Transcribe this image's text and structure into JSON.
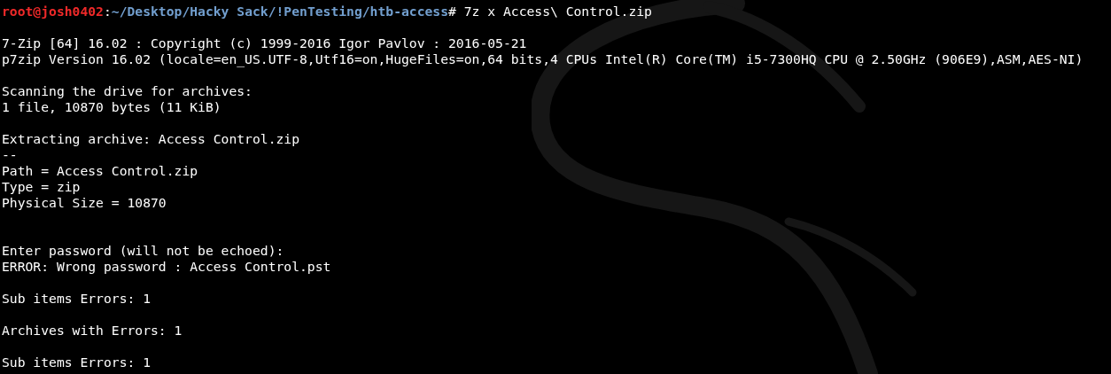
{
  "prompt": {
    "user_host": "root@josh0402",
    "separator": ":",
    "path": "~/Desktop/Hacky Sack/!PenTesting/htb-access",
    "symbol": "#",
    "command": " 7z x Access\\ Control.zip"
  },
  "lines": [
    {
      "kind": "blank"
    },
    {
      "kind": "output",
      "text": "7-Zip [64] 16.02 : Copyright (c) 1999-2016 Igor Pavlov : 2016-05-21"
    },
    {
      "kind": "output",
      "text": "p7zip Version 16.02 (locale=en_US.UTF-8,Utf16=on,HugeFiles=on,64 bits,4 CPUs Intel(R) Core(TM) i5-7300HQ CPU @ 2.50GHz (906E9),ASM,AES-NI)"
    },
    {
      "kind": "blank"
    },
    {
      "kind": "output",
      "text": "Scanning the drive for archives:"
    },
    {
      "kind": "output",
      "text": "1 file, 10870 bytes (11 KiB)"
    },
    {
      "kind": "blank"
    },
    {
      "kind": "output",
      "text": "Extracting archive: Access Control.zip"
    },
    {
      "kind": "output",
      "text": "--"
    },
    {
      "kind": "output",
      "text": "Path = Access Control.zip"
    },
    {
      "kind": "output",
      "text": "Type = zip"
    },
    {
      "kind": "output",
      "text": "Physical Size = 10870"
    },
    {
      "kind": "blank"
    },
    {
      "kind": "blank"
    },
    {
      "kind": "output",
      "text": "Enter password (will not be echoed):"
    },
    {
      "kind": "output",
      "text": "ERROR: Wrong password : Access Control.pst"
    },
    {
      "kind": "blank"
    },
    {
      "kind": "output",
      "text": "Sub items Errors: 1"
    },
    {
      "kind": "blank"
    },
    {
      "kind": "output",
      "text": "Archives with Errors: 1"
    },
    {
      "kind": "blank"
    },
    {
      "kind": "output",
      "text": "Sub items Errors: 1"
    }
  ]
}
